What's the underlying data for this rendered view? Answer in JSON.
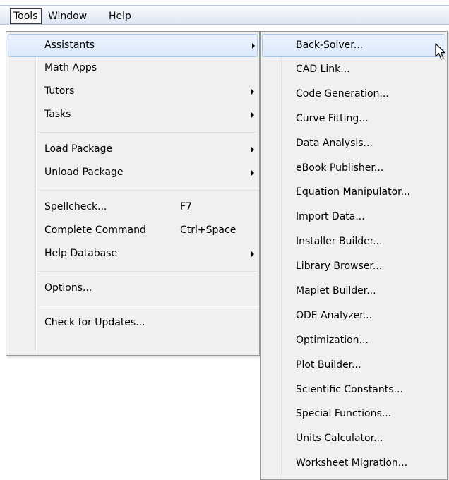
{
  "menubar": {
    "items": [
      {
        "label": "Tools",
        "active": true
      },
      {
        "label": "Window",
        "active": false
      },
      {
        "label": "Help",
        "active": false
      }
    ]
  },
  "tools_menu": {
    "sections": [
      [
        {
          "label": "Assistants",
          "submenu": true,
          "highlighted": true
        },
        {
          "label": "Math Apps"
        },
        {
          "label": "Tutors",
          "submenu": true
        },
        {
          "label": "Tasks",
          "submenu": true
        }
      ],
      [
        {
          "label": "Load Package",
          "submenu": true
        },
        {
          "label": "Unload Package",
          "submenu": true
        }
      ],
      [
        {
          "label": "Spellcheck...",
          "shortcut": "F7"
        },
        {
          "label": "Complete Command",
          "shortcut": "Ctrl+Space"
        },
        {
          "label": "Help Database",
          "submenu": true
        }
      ],
      [
        {
          "label": "Options..."
        }
      ],
      [
        {
          "label": "Check for Updates..."
        }
      ]
    ]
  },
  "assistants_menu": {
    "items": [
      {
        "label": "Back-Solver...",
        "highlighted": true
      },
      {
        "label": "CAD Link..."
      },
      {
        "label": "Code Generation..."
      },
      {
        "label": "Curve Fitting..."
      },
      {
        "label": "Data Analysis..."
      },
      {
        "label": "eBook Publisher..."
      },
      {
        "label": "Equation Manipulator..."
      },
      {
        "label": "Import Data..."
      },
      {
        "label": "Installer Builder..."
      },
      {
        "label": "Library Browser..."
      },
      {
        "label": "Maplet Builder..."
      },
      {
        "label": "ODE Analyzer..."
      },
      {
        "label": "Optimization..."
      },
      {
        "label": "Plot Builder..."
      },
      {
        "label": "Scientific Constants..."
      },
      {
        "label": "Special Functions..."
      },
      {
        "label": "Units Calculator..."
      },
      {
        "label": "Worksheet Migration..."
      }
    ]
  },
  "cursor": {
    "icon": "mouse-pointer-icon"
  }
}
